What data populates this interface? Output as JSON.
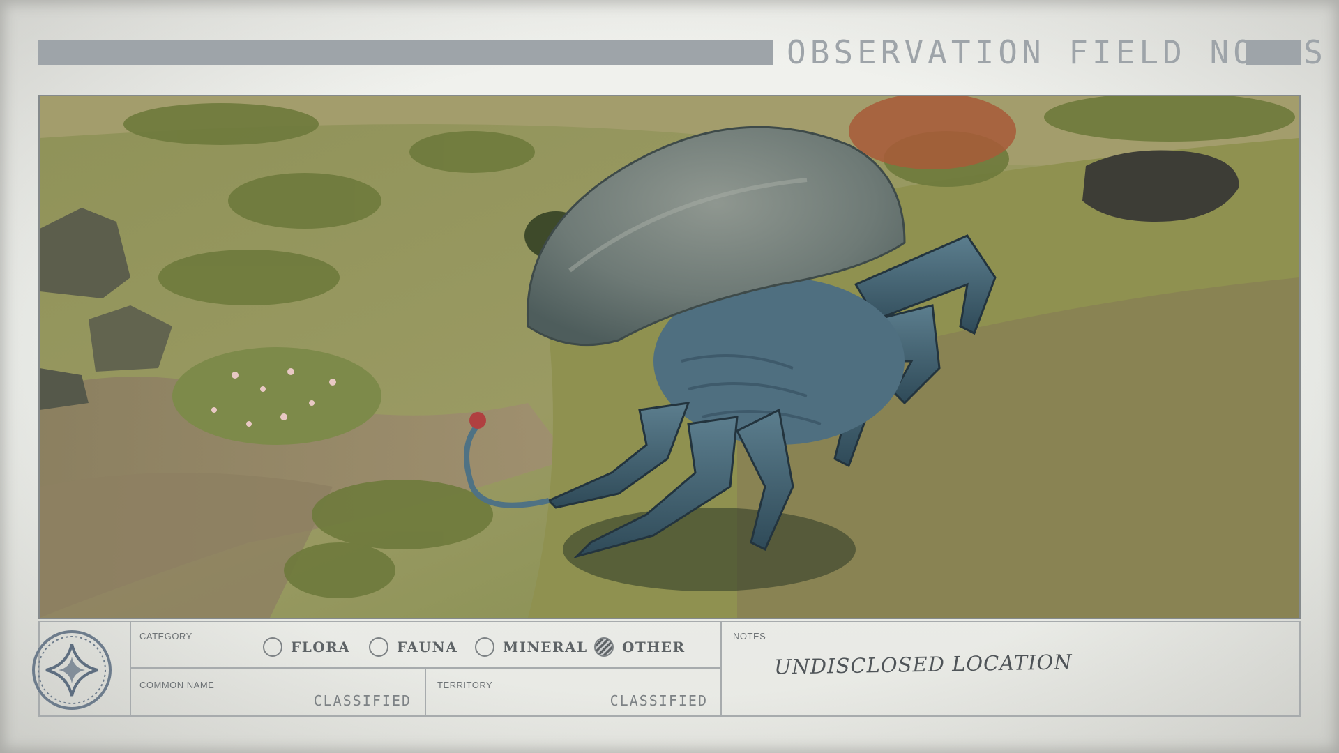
{
  "header": {
    "title": "OBSERVATION FIELD NOTES"
  },
  "photo": {
    "subject": "creature-photo"
  },
  "form": {
    "category_label": "CATEGORY",
    "options": [
      {
        "label": "FLORA",
        "checked": false
      },
      {
        "label": "FAUNA",
        "checked": false
      },
      {
        "label": "MINERAL",
        "checked": false
      },
      {
        "label": "OTHER",
        "checked": true
      }
    ],
    "common_name_label": "COMMON NAME",
    "common_name_value": "CLASSIFIED",
    "territory_label": "TERRITORY",
    "territory_value": "CLASSIFIED",
    "notes_label": "NOTES",
    "notes_value": "UNDISCLOSED LOCATION"
  }
}
